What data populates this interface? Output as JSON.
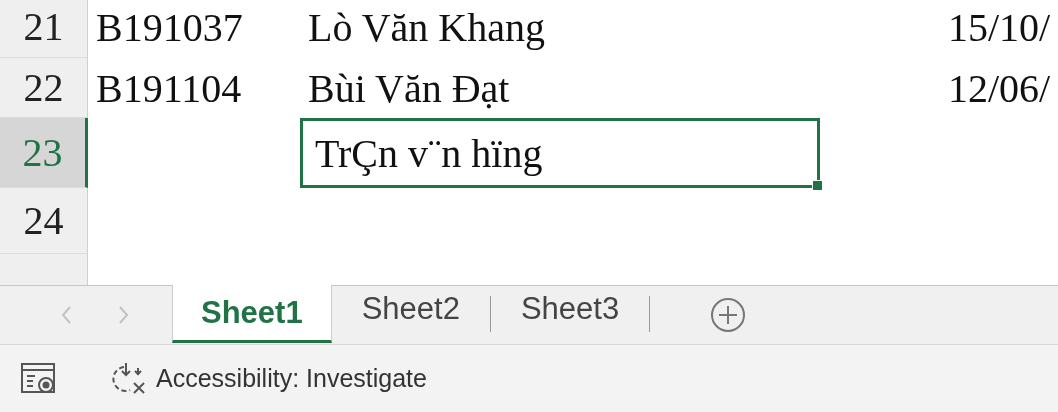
{
  "grid": {
    "rows": [
      {
        "number": "21",
        "selected": false,
        "cells": [
          {
            "text": "B191037",
            "selected": false
          },
          {
            "text": "Lò Văn Khang",
            "selected": false
          },
          {
            "text": "15/10/",
            "selected": false
          }
        ]
      },
      {
        "number": "22",
        "selected": false,
        "cells": [
          {
            "text": "B191104",
            "selected": false
          },
          {
            "text": "Bùi Văn Đạt",
            "selected": false
          },
          {
            "text": "12/06/",
            "selected": false
          }
        ]
      },
      {
        "number": "23",
        "selected": true,
        "cells": [
          {
            "text": "",
            "selected": false
          },
          {
            "text": "TrÇn v¨n hïng",
            "selected": true
          },
          {
            "text": "",
            "selected": false
          }
        ]
      },
      {
        "number": "24",
        "selected": false,
        "cells": []
      }
    ]
  },
  "sheet_tabs": [
    {
      "label": "Sheet1",
      "selected": true
    },
    {
      "label": "Sheet2",
      "selected": false
    },
    {
      "label": "Sheet3",
      "selected": false
    }
  ],
  "status_bar": {
    "accessibility": "Accessibility: Investigate"
  }
}
